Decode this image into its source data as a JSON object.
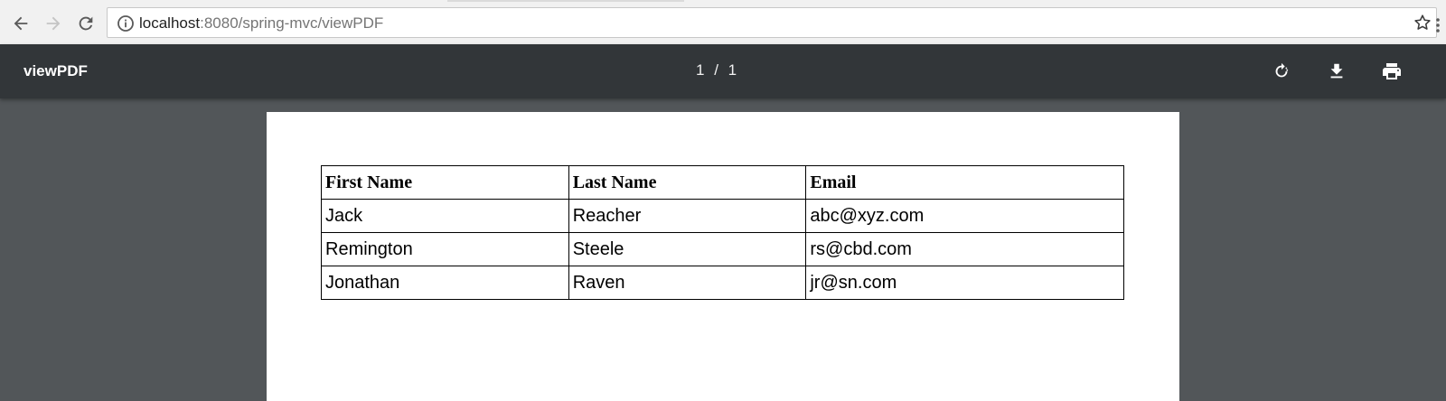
{
  "browser": {
    "url_host": "localhost",
    "url_path": ":8080/spring-mvc/viewPDF"
  },
  "pdf_viewer": {
    "title": "viewPDF",
    "current_page": "1",
    "separator": "/",
    "total_pages": "1"
  },
  "document": {
    "table": {
      "headers": [
        "First Name",
        "Last Name",
        "Email"
      ],
      "rows": [
        [
          "Jack",
          "Reacher",
          "abc@xyz.com"
        ],
        [
          "Remington",
          "Steele",
          "rs@cbd.com"
        ],
        [
          "Jonathan",
          "Raven",
          "jr@sn.com"
        ]
      ]
    }
  },
  "colors": {
    "pdf_toolbar": "#323639",
    "viewer_background": "#525659",
    "browser_chrome": "#f1f1f1"
  }
}
